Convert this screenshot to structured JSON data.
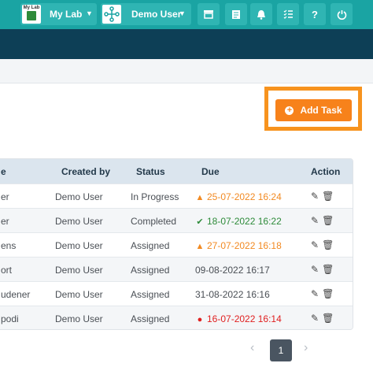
{
  "nav": {
    "lab_logo_text": "My Lab",
    "lab_label": "My Lab",
    "user_label": "Demo User"
  },
  "add_task_label": "Add Task",
  "table": {
    "headers": [
      "e",
      "Created by",
      "Status",
      "Due",
      "Action"
    ],
    "rows": [
      {
        "name": "er",
        "created_by": "Demo User",
        "status": "In Progress",
        "due": "25-07-2022 16:24",
        "due_status": "warning"
      },
      {
        "name": "er",
        "created_by": "Demo User",
        "status": "Completed",
        "due": "18-07-2022 16:22",
        "due_status": "done"
      },
      {
        "name": "ens",
        "created_by": "Demo User",
        "status": "Assigned",
        "due": "27-07-2022 16:18",
        "due_status": "warning"
      },
      {
        "name": "ort",
        "created_by": "Demo User",
        "status": "Assigned",
        "due": "09-08-2022 16:17",
        "due_status": "normal"
      },
      {
        "name": "udener",
        "created_by": "Demo User",
        "status": "Assigned",
        "due": "31-08-2022 16:16",
        "due_status": "normal"
      },
      {
        "name": "podi",
        "created_by": "Demo User",
        "status": "Assigned",
        "due": "16-07-2022 16:14",
        "due_status": "overdue"
      }
    ]
  },
  "pagination": {
    "current": "1"
  },
  "colors": {
    "nav": "#1aa4a3",
    "dark_bar": "#0d3f56",
    "accent": "#f7821b"
  }
}
